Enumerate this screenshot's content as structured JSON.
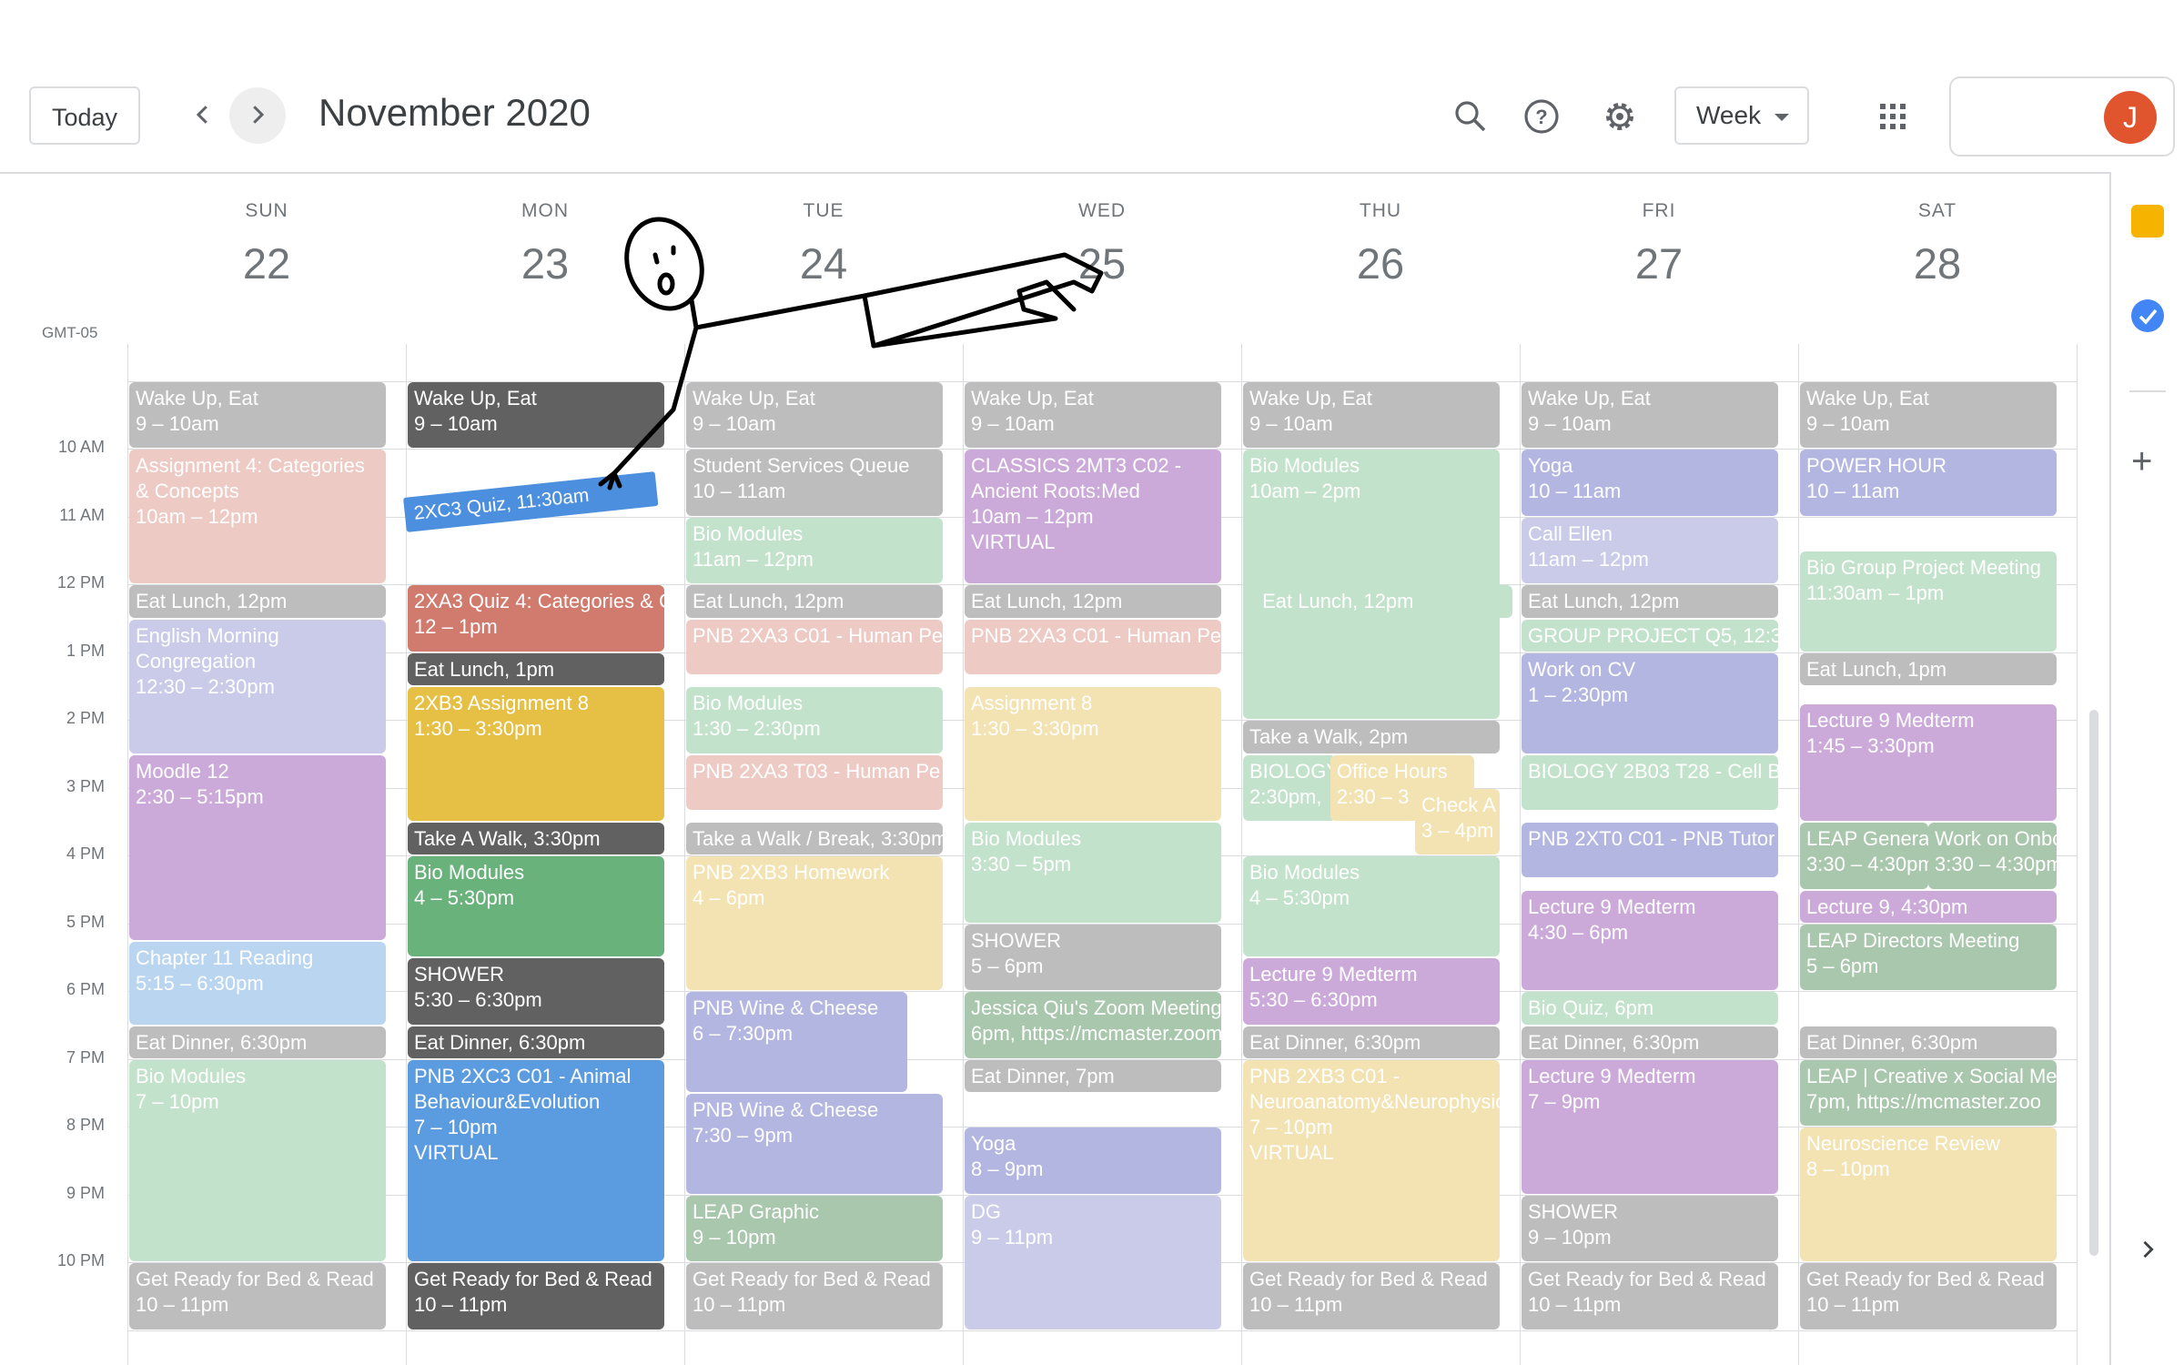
{
  "header": {
    "today_label": "Today",
    "month_title": "November 2020",
    "view_label": "Week",
    "avatar_initial": "J",
    "icons": [
      "search-icon",
      "help-icon",
      "settings-icon",
      "apps-grid-icon"
    ]
  },
  "timezone": "GMT-05",
  "days": [
    {
      "dow": "SUN",
      "num": "22"
    },
    {
      "dow": "MON",
      "num": "23"
    },
    {
      "dow": "TUE",
      "num": "24"
    },
    {
      "dow": "WED",
      "num": "25"
    },
    {
      "dow": "THU",
      "num": "26"
    },
    {
      "dow": "FRI",
      "num": "27"
    },
    {
      "dow": "SAT",
      "num": "28"
    }
  ],
  "time_labels": [
    "10 AM",
    "11 AM",
    "12 PM",
    "1 PM",
    "2 PM",
    "3 PM",
    "4 PM",
    "5 PM",
    "6 PM",
    "7 PM",
    "8 PM",
    "9 PM",
    "10 PM"
  ],
  "overlay_tag": "2XC3 Quiz, 11:30am",
  "events": [
    {
      "day": 0,
      "title": "Wake Up, Eat",
      "time": "9 – 10am",
      "color": "c-gray",
      "start": 9,
      "end": 10
    },
    {
      "day": 0,
      "title": "Assignment 4: Categories & Concepts",
      "time": "10am – 12pm",
      "color": "c-pink",
      "start": 10,
      "end": 12
    },
    {
      "day": 0,
      "title": "Eat Lunch, 12pm",
      "time": "",
      "color": "c-gray",
      "start": 12,
      "end": 12.5
    },
    {
      "day": 0,
      "title": "English Morning Congregation",
      "time": "12:30 – 2:30pm",
      "color": "c-lav",
      "start": 12.5,
      "end": 14.5
    },
    {
      "day": 0,
      "title": "Moodle 12",
      "time": "2:30 – 5:15pm",
      "color": "c-purple",
      "start": 14.5,
      "end": 17.25
    },
    {
      "day": 0,
      "title": "Chapter 11 Reading",
      "time": "5:15 – 6:30pm",
      "color": "c-lblue",
      "start": 17.25,
      "end": 18.5
    },
    {
      "day": 0,
      "title": "Eat Dinner, 6:30pm",
      "time": "",
      "color": "c-gray",
      "start": 18.5,
      "end": 19
    },
    {
      "day": 0,
      "title": "Bio Modules",
      "time": "7 – 10pm",
      "color": "c-mint",
      "start": 19,
      "end": 22
    },
    {
      "day": 0,
      "title": "Get Ready for Bed & Read",
      "time": "10 – 11pm",
      "color": "c-gray",
      "start": 22,
      "end": 23
    },
    {
      "day": 1,
      "title": "Wake Up, Eat",
      "time": "9 – 10am",
      "color": "c-dgray",
      "start": 9,
      "end": 10
    },
    {
      "day": 1,
      "title": "2XA3 Quiz 4: Categories & C",
      "time": "12 – 1pm",
      "color": "c-red",
      "start": 12,
      "end": 13
    },
    {
      "day": 1,
      "title": "Eat Lunch, 1pm",
      "time": "",
      "color": "c-dgray",
      "start": 13,
      "end": 13.5
    },
    {
      "day": 1,
      "title": "2XB3 Assignment 8",
      "time": "1:30 – 3:30pm",
      "color": "c-yellow",
      "start": 13.5,
      "end": 15.5
    },
    {
      "day": 1,
      "title": "Take A Walk, 3:30pm",
      "time": "",
      "color": "c-dgray",
      "start": 15.5,
      "end": 16
    },
    {
      "day": 1,
      "title": "Bio Modules",
      "time": "4 – 5:30pm",
      "color": "c-green",
      "start": 16,
      "end": 17.5
    },
    {
      "day": 1,
      "title": "SHOWER",
      "time": "5:30 – 6:30pm",
      "color": "c-dgray",
      "start": 17.5,
      "end": 18.5
    },
    {
      "day": 1,
      "title": "Eat Dinner, 6:30pm",
      "time": "",
      "color": "c-dgray",
      "start": 18.5,
      "end": 19
    },
    {
      "day": 1,
      "title": "PNB 2XC3 C01 - Animal Behaviour&Evolution",
      "time": "7 – 10pm",
      "extra": "VIRTUAL",
      "color": "c-blue",
      "start": 19,
      "end": 22
    },
    {
      "day": 1,
      "title": "Get Ready for Bed & Read",
      "time": "10 – 11pm",
      "color": "c-dgray",
      "start": 22,
      "end": 23
    },
    {
      "day": 2,
      "title": "Wake Up, Eat",
      "time": "9 – 10am",
      "color": "c-gray",
      "start": 9,
      "end": 10
    },
    {
      "day": 2,
      "title": "Student Services Queue",
      "time": "10 – 11am",
      "color": "c-gray",
      "start": 10,
      "end": 11
    },
    {
      "day": 2,
      "title": "Bio Modules",
      "time": "11am – 12pm",
      "color": "c-mint",
      "start": 11,
      "end": 12
    },
    {
      "day": 2,
      "title": "Eat Lunch, 12pm",
      "time": "",
      "color": "c-gray",
      "start": 12,
      "end": 12.5
    },
    {
      "day": 2,
      "title": "PNB 2XA3 C01 - Human Pe",
      "time": "",
      "color": "c-pink",
      "start": 12.5,
      "end": 13.33
    },
    {
      "day": 2,
      "title": "Bio Modules",
      "time": "1:30 – 2:30pm",
      "color": "c-mint",
      "start": 13.5,
      "end": 14.5
    },
    {
      "day": 2,
      "title": "PNB 2XA3 T03 - Human Pe",
      "time": "",
      "color": "c-pink",
      "start": 14.5,
      "end": 15.33
    },
    {
      "day": 2,
      "title": "Take a Walk / Break, 3:30pm",
      "time": "",
      "color": "c-gray",
      "start": 15.5,
      "end": 16
    },
    {
      "day": 2,
      "title": "PNB 2XB3 Homework",
      "time": "4 – 6pm",
      "color": "c-lyellow",
      "start": 16,
      "end": 18
    },
    {
      "day": 2,
      "title": "PNB Wine & Cheese",
      "time": "6 – 7:30pm",
      "color": "c-blav",
      "start": 18,
      "end": 19.5,
      "w": 0.86
    },
    {
      "day": 2,
      "title": "PNB Wine & Cheese",
      "time": "7:30 – 9pm",
      "color": "c-blav",
      "start": 19.5,
      "end": 21
    },
    {
      "day": 2,
      "title": "LEAP Graphic",
      "time": "9 – 10pm",
      "color": "c-sage",
      "start": 21,
      "end": 22
    },
    {
      "day": 2,
      "title": "Get Ready for Bed & Read",
      "time": "10 – 11pm",
      "color": "c-gray",
      "start": 22,
      "end": 23
    },
    {
      "day": 3,
      "title": "Wake Up, Eat",
      "time": "9 – 10am",
      "color": "c-gray",
      "start": 9,
      "end": 10
    },
    {
      "day": 3,
      "title": "CLASSICS 2MT3 C02 - Ancient Roots:Med",
      "time": "10am – 12pm",
      "extra": "VIRTUAL",
      "color": "c-purple",
      "start": 10,
      "end": 12
    },
    {
      "day": 3,
      "title": "Eat Lunch, 12pm",
      "time": "",
      "color": "c-gray",
      "start": 12,
      "end": 12.5
    },
    {
      "day": 3,
      "title": "PNB 2XA3 C01 - Human Pe",
      "time": "",
      "color": "c-pink",
      "start": 12.5,
      "end": 13.33
    },
    {
      "day": 3,
      "title": "Assignment 8",
      "time": "1:30 – 3:30pm",
      "color": "c-lyellow",
      "start": 13.5,
      "end": 15.5
    },
    {
      "day": 3,
      "title": "Bio Modules",
      "time": "3:30 – 5pm",
      "color": "c-mint",
      "start": 15.5,
      "end": 17
    },
    {
      "day": 3,
      "title": "SHOWER",
      "time": "5 – 6pm",
      "color": "c-gray",
      "start": 17,
      "end": 18
    },
    {
      "day": 3,
      "title": "Jessica Qiu's Zoom Meeting",
      "time": "6pm, https://mcmaster.zoom",
      "color": "c-sage",
      "start": 18,
      "end": 19
    },
    {
      "day": 3,
      "title": "Eat Dinner, 7pm",
      "time": "",
      "color": "c-gray",
      "start": 19,
      "end": 19.5
    },
    {
      "day": 3,
      "title": "Yoga",
      "time": "8 – 9pm",
      "color": "c-blav",
      "start": 20,
      "end": 21
    },
    {
      "day": 3,
      "title": "DG",
      "time": "9 – 11pm",
      "color": "c-lav",
      "start": 21,
      "end": 23
    },
    {
      "day": 4,
      "title": "Wake Up, Eat",
      "time": "9 – 10am",
      "color": "c-gray",
      "start": 9,
      "end": 10
    },
    {
      "day": 4,
      "title": "Bio Modules",
      "time": "10am – 2pm",
      "color": "c-mint",
      "start": 10,
      "end": 14
    },
    {
      "day": 4,
      "title": "Eat Lunch, 12pm",
      "time": "",
      "color": "c-mint",
      "start": 12,
      "end": 12.5,
      "x": 0.05
    },
    {
      "day": 4,
      "title": "Take a Walk, 2pm",
      "time": "",
      "color": "c-gray",
      "start": 14,
      "end": 14.5
    },
    {
      "day": 4,
      "title": "BIOLOGY",
      "time": "2:30pm,",
      "color": "c-mint",
      "start": 14.5,
      "end": 15.5,
      "w": 0.36
    },
    {
      "day": 4,
      "title": "Office Hours",
      "time": "2:30 – 3",
      "color": "c-lyellow",
      "start": 14.5,
      "end": 15.5,
      "x": 0.34,
      "w": 0.56
    },
    {
      "day": 4,
      "title": "Check A",
      "time": "3 – 4pm",
      "color": "c-lyellow",
      "start": 15,
      "end": 16,
      "x": 0.67,
      "w": 0.33
    },
    {
      "day": 4,
      "title": "Bio Modules",
      "time": "4 – 5:30pm",
      "color": "c-mint",
      "start": 16,
      "end": 17.5
    },
    {
      "day": 4,
      "title": "Lecture 9 Medterm",
      "time": "5:30 – 6:30pm",
      "color": "c-purple",
      "start": 17.5,
      "end": 18.5
    },
    {
      "day": 4,
      "title": "Eat Dinner, 6:30pm",
      "time": "",
      "color": "c-gray",
      "start": 18.5,
      "end": 19
    },
    {
      "day": 4,
      "title": "PNB 2XB3 C01 - Neuroanatomy&Neurophysiology",
      "time": "7 – 10pm",
      "extra": "VIRTUAL",
      "color": "c-lyellow",
      "start": 19,
      "end": 22
    },
    {
      "day": 4,
      "title": "Get Ready for Bed & Read",
      "time": "10 – 11pm",
      "color": "c-gray",
      "start": 22,
      "end": 23
    },
    {
      "day": 5,
      "title": "Wake Up, Eat",
      "time": "9 – 10am",
      "color": "c-gray",
      "start": 9,
      "end": 10
    },
    {
      "day": 5,
      "title": "Yoga",
      "time": "10 – 11am",
      "color": "c-blav",
      "start": 10,
      "end": 11
    },
    {
      "day": 5,
      "title": "Call Ellen",
      "time": "11am – 12pm",
      "color": "c-lav",
      "start": 11,
      "end": 12
    },
    {
      "day": 5,
      "title": "Eat Lunch, 12pm",
      "time": "",
      "color": "c-gray",
      "start": 12,
      "end": 12.5
    },
    {
      "day": 5,
      "title": "GROUP PROJECT Q5, 12:30",
      "time": "",
      "color": "c-mint",
      "start": 12.5,
      "end": 13
    },
    {
      "day": 5,
      "title": "Work on CV",
      "time": "1 – 2:30pm",
      "color": "c-blav",
      "start": 13,
      "end": 14.5
    },
    {
      "day": 5,
      "title": "BIOLOGY 2B03 T28 - Cell B",
      "time": "",
      "color": "c-mint",
      "start": 14.5,
      "end": 15.33
    },
    {
      "day": 5,
      "title": "PNB 2XT0 C01 - PNB Tutor",
      "time": "",
      "color": "c-blav",
      "start": 15.5,
      "end": 16.33
    },
    {
      "day": 5,
      "title": "Lecture 9 Medterm",
      "time": "4:30 – 6pm",
      "color": "c-purple",
      "start": 16.5,
      "end": 18
    },
    {
      "day": 5,
      "title": "Bio Quiz, 6pm",
      "time": "",
      "color": "c-mint",
      "start": 18,
      "end": 18.5
    },
    {
      "day": 5,
      "title": "Eat Dinner, 6:30pm",
      "time": "",
      "color": "c-gray",
      "start": 18.5,
      "end": 19
    },
    {
      "day": 5,
      "title": "Lecture 9 Medterm",
      "time": "7 – 9pm",
      "color": "c-purple",
      "start": 19,
      "end": 21
    },
    {
      "day": 5,
      "title": "SHOWER",
      "time": "9 – 10pm",
      "color": "c-gray",
      "start": 21,
      "end": 22
    },
    {
      "day": 5,
      "title": "Get Ready for Bed & Read",
      "time": "10 – 11pm",
      "color": "c-gray",
      "start": 22,
      "end": 23
    },
    {
      "day": 6,
      "title": "Wake Up, Eat",
      "time": "9 – 10am",
      "color": "c-gray",
      "start": 9,
      "end": 10
    },
    {
      "day": 6,
      "title": "POWER HOUR",
      "time": "10 – 11am",
      "color": "c-blav",
      "start": 10,
      "end": 11
    },
    {
      "day": 6,
      "title": "Bio Group Project Meeting",
      "time": "11:30am – 1pm",
      "color": "c-mint",
      "start": 11.5,
      "end": 13
    },
    {
      "day": 6,
      "title": "Eat Lunch, 1pm",
      "time": "",
      "color": "c-gray",
      "start": 13,
      "end": 13.5
    },
    {
      "day": 6,
      "title": "Lecture 9 Medterm",
      "time": "1:45 – 3:30pm",
      "color": "c-purple",
      "start": 13.75,
      "end": 15.5
    },
    {
      "day": 6,
      "title": "LEAP Genera",
      "time": "3:30 – 4:30pm",
      "color": "c-sage",
      "start": 15.5,
      "end": 16.5,
      "w": 0.5
    },
    {
      "day": 6,
      "title": "Work on Onbo",
      "time": "3:30 – 4:30pm",
      "color": "c-sage",
      "start": 15.5,
      "end": 16.5,
      "x": 0.5,
      "w": 0.5
    },
    {
      "day": 6,
      "title": "Lecture 9, 4:30pm",
      "time": "",
      "color": "c-purple",
      "start": 16.5,
      "end": 17
    },
    {
      "day": 6,
      "title": "LEAP Directors Meeting",
      "time": "5 – 6pm",
      "color": "c-sage",
      "start": 17,
      "end": 18
    },
    {
      "day": 6,
      "title": "Eat Dinner, 6:30pm",
      "time": "",
      "color": "c-gray",
      "start": 18.5,
      "end": 19
    },
    {
      "day": 6,
      "title": "LEAP | Creative x Social Me",
      "time": "7pm, https://mcmaster.zoo",
      "color": "c-sage",
      "start": 19,
      "end": 20
    },
    {
      "day": 6,
      "title": "Neuroscience Review",
      "time": "8 – 10pm",
      "color": "c-lyellow",
      "start": 20,
      "end": 22
    },
    {
      "day": 6,
      "title": "Get Ready for Bed & Read",
      "time": "10 – 11pm",
      "color": "c-gray",
      "start": 22,
      "end": 23
    }
  ]
}
